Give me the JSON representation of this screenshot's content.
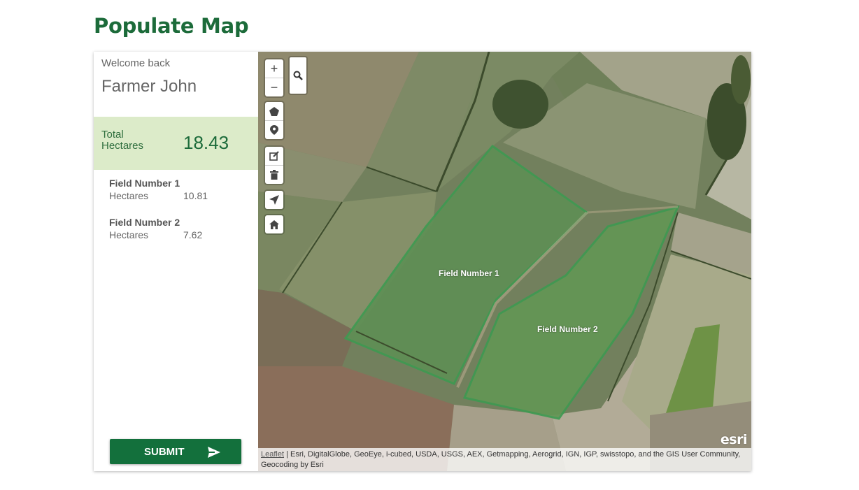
{
  "page": {
    "title": "Populate Map"
  },
  "sidebar": {
    "welcome": "Welcome back",
    "user_name": "Farmer John",
    "total": {
      "label": "Total Hectares",
      "value": "18.43"
    },
    "fields": [
      {
        "name": "Field Number 1",
        "hectares_label": "Hectares",
        "hectares": "10.81"
      },
      {
        "name": "Field Number 2",
        "hectares_label": "Hectares",
        "hectares": "7.62"
      }
    ],
    "submit_label": "SUBMIT"
  },
  "map": {
    "controls": {
      "zoom_in": "+",
      "zoom_out": "−",
      "icons": [
        "search-icon",
        "polygon-icon",
        "marker-icon",
        "edit-icon",
        "trash-icon",
        "locate-icon",
        "home-icon"
      ]
    },
    "field_labels": [
      "Field Number 1",
      "Field Number 2"
    ],
    "logo": "esri",
    "attribution": {
      "link": "Leaflet",
      "text": " | Esri, DigitalGlobe, GeoEye, i-cubed, USDA, USGS, AEX, Getmapping, Aerogrid, IGN, IGP, swisstopo, and the GIS User Community, Geocoding by Esri"
    }
  },
  "colors": {
    "brand_green": "#1c6b3a",
    "button_green": "#13703c",
    "total_bg": "#dcebc9",
    "field_outline": "#3f9a52"
  }
}
